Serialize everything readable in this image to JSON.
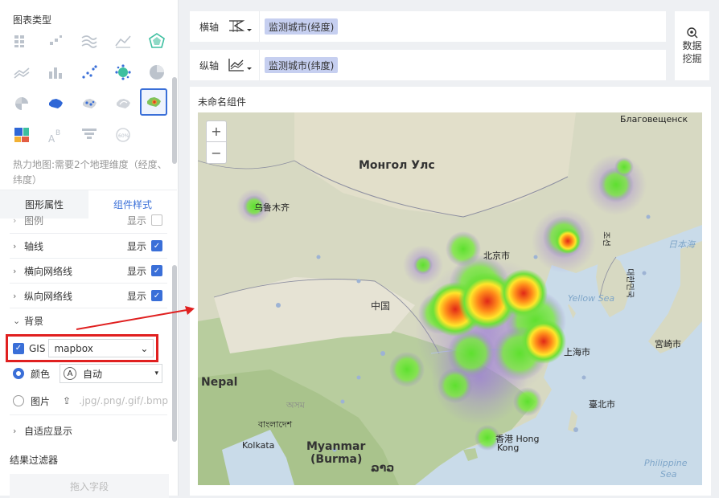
{
  "left_panel": {
    "chart_types_title": "图表类型",
    "hint": "热力地图:需要2个地理维度（经度、纬度）",
    "tabs": [
      "图形属性",
      "组件样式"
    ],
    "rows": {
      "legend_label": "图例",
      "legend_show": "显示",
      "axis_label": "轴线",
      "axis_show": "显示",
      "hgrid_label": "横向网络线",
      "hgrid_show": "显示",
      "vgrid_label": "纵向网络线",
      "vgrid_show": "显示",
      "background_label": "背景",
      "gis_label": "GIS",
      "gis_value": "mapbox",
      "color_label": "颜色",
      "color_value": "自动",
      "image_label": "图片",
      "image_hint": ".jpg/.png/.gif/.bmp",
      "adaptive_label": "自适应显示"
    },
    "result_filter_title": "结果过滤器",
    "drop_hint": "拖入字段"
  },
  "axes": {
    "x_label": "横轴",
    "x_field": "监测城市(经度)",
    "y_label": "纵轴",
    "y_field": "监测城市(纬度)"
  },
  "data_mining": {
    "line1": "数据",
    "line2": "挖掘"
  },
  "chart": {
    "title": "未命名组件",
    "zoom_in": "+",
    "zoom_out": "−",
    "labels": {
      "blagoveshchensk": "Благовещенск",
      "mongolia": "Монгол Улс",
      "urumqi": "乌鲁木齐",
      "beijing": "北京市",
      "china": "中国",
      "yellow_sea": "Yellow Sea",
      "shanghai": "上海市",
      "nepal": "Nepal",
      "kolkata": "Kolkata",
      "myanmar1": "Myanmar",
      "myanmar2": "(Burma)",
      "hongkong1": "香港 Hong",
      "hongkong2": "Kong",
      "taipei": "臺北市",
      "miyakojima": "宮崎市",
      "philippine1": "Philippine",
      "philippine2": "Sea",
      "japan_sea1": "日本海",
      "japan_sea2": "日本海",
      "korea": "대한민국",
      "dprk": "조선",
      "bangla": "বাংলাদেশ",
      "assam": "অসম",
      "lao": "ລາວ"
    }
  },
  "colors": {
    "accent": "#3a6fd8",
    "highlight_border": "#e02020",
    "field_tag": "#c6cff0"
  }
}
